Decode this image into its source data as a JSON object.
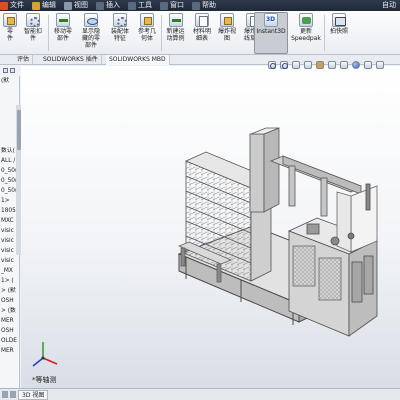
{
  "menu": {
    "items": [
      {
        "label": "文件",
        "color": "#e44b1d"
      },
      {
        "label": "编辑",
        "color": "#d6a428"
      },
      {
        "label": "视图",
        "color": "#8c98a8"
      },
      {
        "label": "插入",
        "color": "#5a6b80"
      },
      {
        "label": "工具",
        "color": "#5a6b80"
      },
      {
        "label": "窗口",
        "color": "#5a6b80"
      },
      {
        "label": "帮助",
        "color": "#5a6b80"
      }
    ],
    "right_text": "自动"
  },
  "ribbon": {
    "buttons": [
      {
        "label": "零\n件",
        "icon": "cube-icon"
      },
      {
        "label": "智能扣\n件",
        "icon": "gear-icon"
      },
      {
        "label": "移动零\n部件",
        "icon": "arrow-icon"
      },
      {
        "label": "显示隐\n藏的零\n部件",
        "icon": "eye-icon"
      },
      {
        "label": "装配体\n特征",
        "icon": "gear-icon"
      },
      {
        "label": "参考几\n何体",
        "icon": "cube-icon"
      },
      {
        "label": "新建运\n动算例",
        "icon": "arrow-icon"
      },
      {
        "label": "材料明\n细表",
        "icon": "doc-icon"
      },
      {
        "label": "爆炸视\n图",
        "icon": "cube-icon"
      },
      {
        "label": "爆炸直\n线草图",
        "icon": "doc-icon"
      },
      {
        "label": "Instant3D",
        "icon": "instant3d-icon",
        "active": true
      },
      {
        "label": "更新\nSpeedpak",
        "icon": "speedpak-icon"
      },
      {
        "label": "拍快照",
        "icon": "snapshot-icon"
      }
    ]
  },
  "tabs": [
    "评估",
    "SOLIDWORKS 插件",
    "SOLIDWORKS MBD"
  ],
  "tree": {
    "items": [
      "(默",
      "",
      "",
      "",
      "",
      "",
      "",
      "数认(",
      "ALL /",
      "0_50(",
      "0_50(",
      "0_50(",
      "1>",
      "1805",
      "MXC",
      "visic",
      "visic",
      "visic",
      "visic",
      "_MX",
      "1> (",
      "> (默",
      "OSH",
      "> (数",
      "MER",
      "OSH",
      "OLDE",
      "MER"
    ]
  },
  "viewport": {
    "view_label": "*等轴测",
    "ref_text": "\"|"
  },
  "colors": {
    "accent": "#2f3a4e",
    "frame": "#5e5e5e",
    "bg": "#eef1f5"
  },
  "status": {
    "tabs": [
      "3D 视图"
    ]
  }
}
